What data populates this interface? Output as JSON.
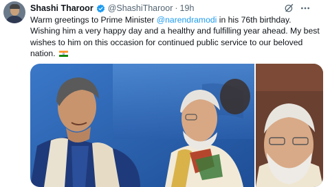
{
  "tweet": {
    "author_name": "Shashi Tharoor",
    "author_handle": "@ShashiTharoor",
    "separator": "·",
    "time": "19h",
    "text_intro": "Warm greetings to Prime Minister ",
    "mention": "@narendramodi",
    "text_rest": " in his 76th birthday. Wishing him a very happy day and a healthy and fulfilling year ahead. My best wishes to him on this occasion for continued public service to our beloved nation.",
    "flag_icon": "india-flag-icon"
  },
  "icons": {
    "verified": "verified-badge-icon",
    "grok": "grok-icon",
    "more": "more-icon"
  },
  "colors": {
    "accent": "#1d9bf0",
    "text": "#0f1419",
    "muted": "#536471"
  }
}
